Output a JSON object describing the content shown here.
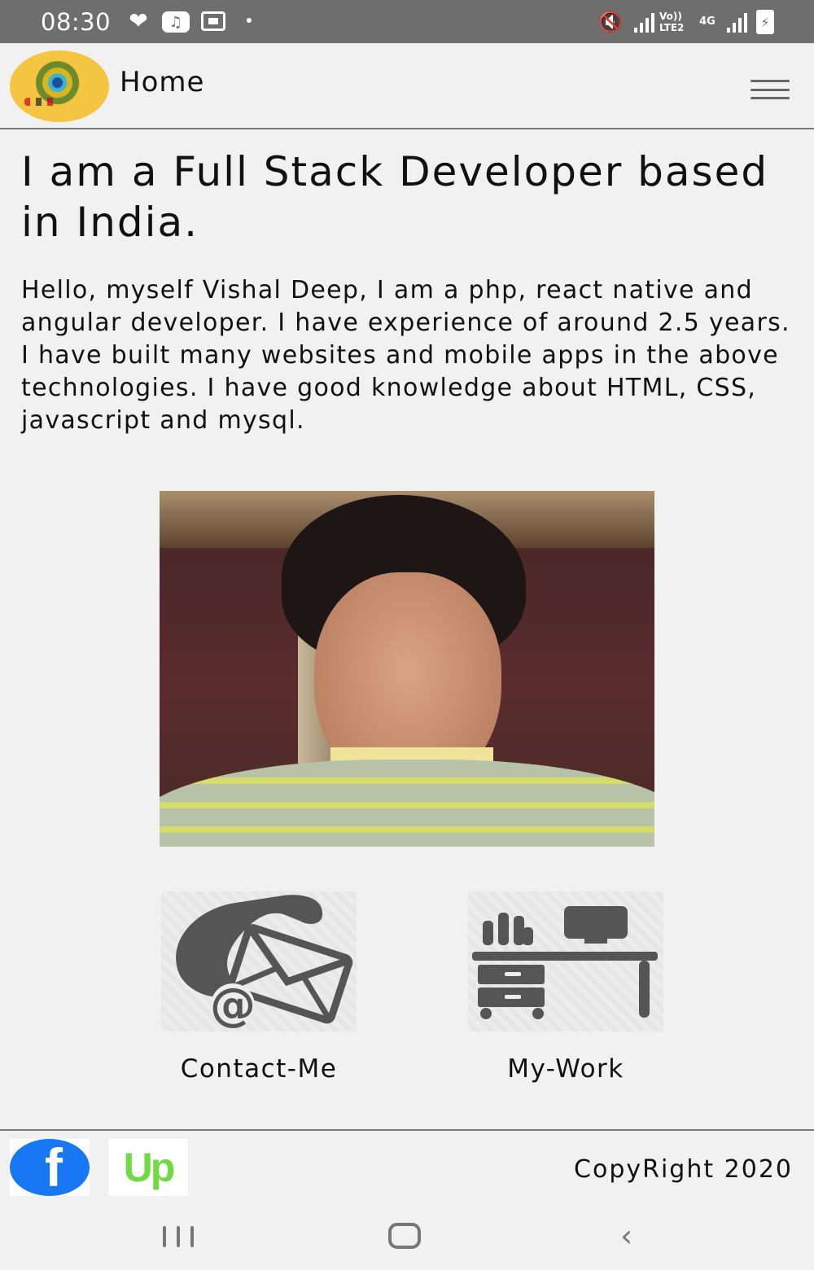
{
  "status_bar": {
    "time": "08:30",
    "volte_label": "Vo)) LTE2",
    "network_label": "4G"
  },
  "header": {
    "title": "Home"
  },
  "main": {
    "headline": "I am a Full Stack Developer based in India.",
    "intro": "Hello, myself Vishal Deep, I am a php, react native and angular developer. I have experience of around 2.5 years. I have built many websites and mobile apps in the above technologies. I have good knowledge about HTML, CSS, javascript and mysql."
  },
  "actions": [
    {
      "label": "Contact-Me",
      "icon": "phone-mail-icon"
    },
    {
      "label": "My-Work",
      "icon": "desk-workstation-icon"
    }
  ],
  "footer": {
    "social": [
      {
        "name": "facebook",
        "icon": "facebook-icon",
        "glyph": "f"
      },
      {
        "name": "upwork",
        "icon": "upwork-icon",
        "glyph": "Up"
      }
    ],
    "copyright": "CopyRight 2020"
  },
  "colors": {
    "status_bar": "#6e6e6e",
    "background": "#f1f1f1",
    "facebook": "#1877f2",
    "upwork": "#6fda44",
    "icon_gray": "#555555"
  }
}
